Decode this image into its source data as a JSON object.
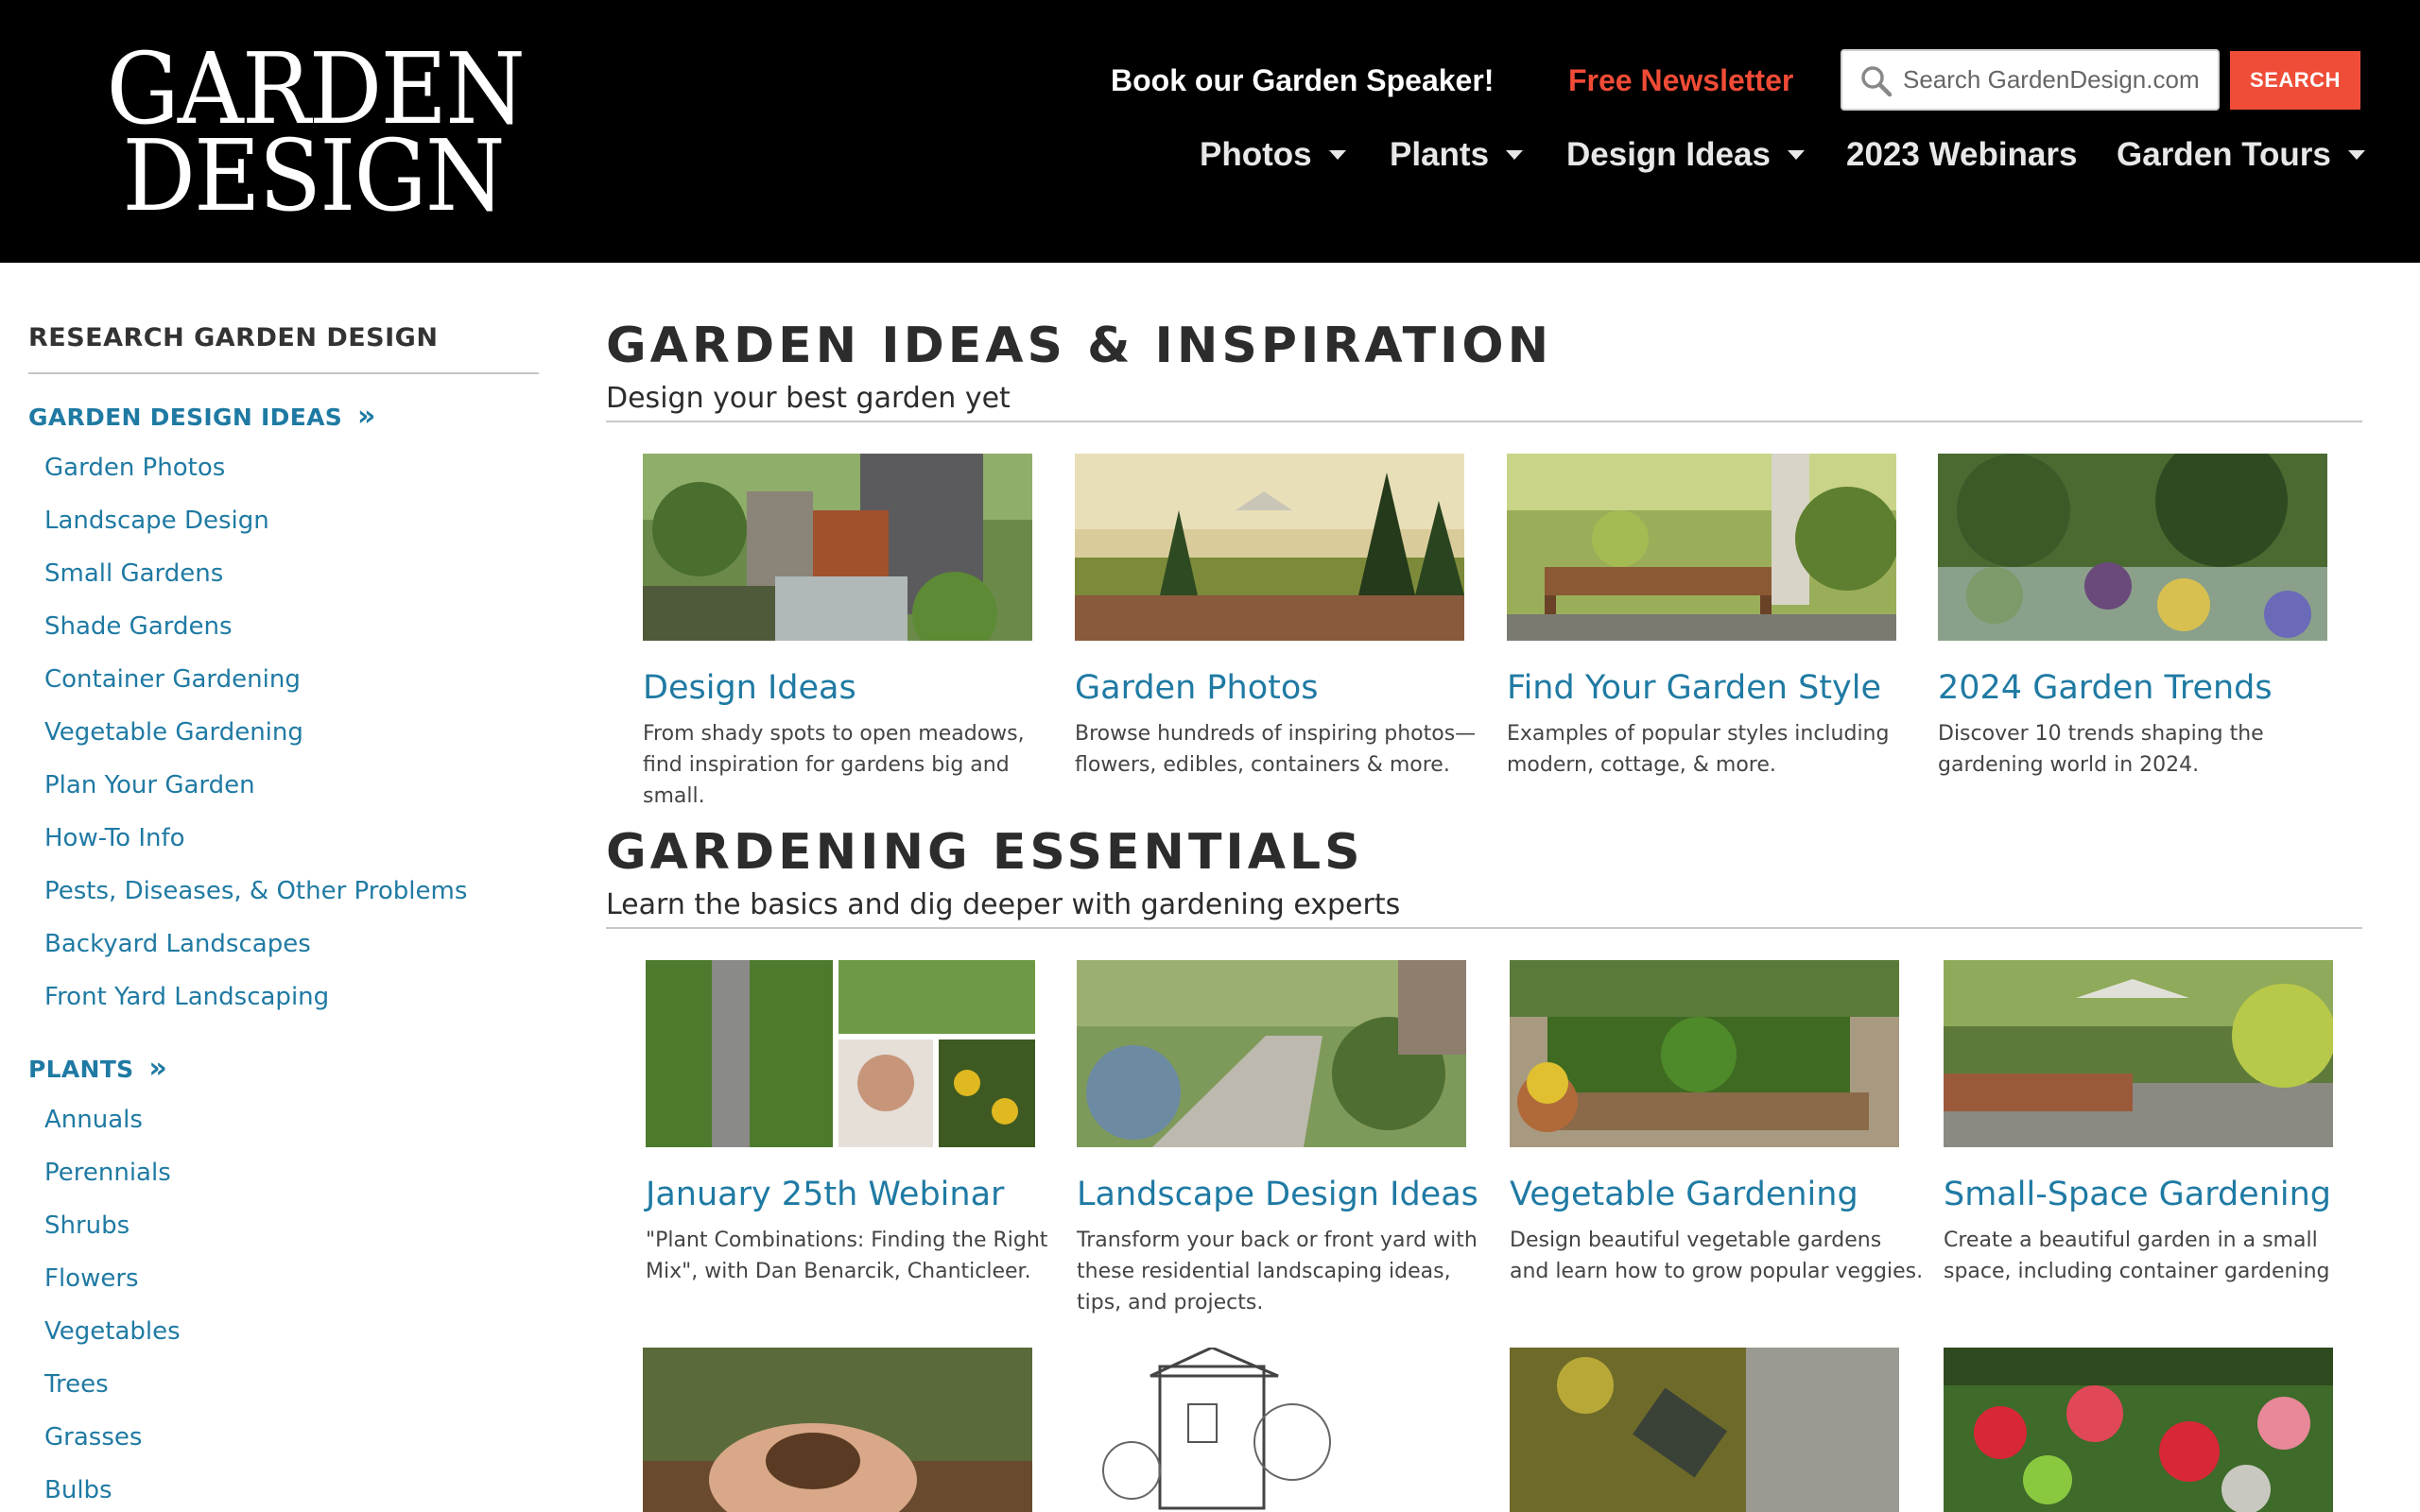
{
  "header": {
    "logo_line1": "GARDEN",
    "logo_line2": "DESIGN",
    "speaker_link": "Book our Garden Speaker!",
    "newsletter_link": "Free Newsletter",
    "search_placeholder": "Search GardenDesign.com",
    "search_button": "SEARCH",
    "nav": {
      "photos": "Photos",
      "plants": "Plants",
      "design_ideas": "Design Ideas",
      "webinars": "2023 Webinars",
      "garden_tours": "Garden Tours"
    },
    "colors": {
      "background": "#000000",
      "accent": "#ef4d37",
      "link": "#1f7aa3"
    }
  },
  "sidebar": {
    "heading": "RESEARCH GARDEN DESIGN",
    "cat1": {
      "label": "GARDEN DESIGN IDEAS",
      "items": [
        "Garden Photos",
        "Landscape Design",
        "Small Gardens",
        "Shade Gardens",
        "Container Gardening",
        "Vegetable Gardening",
        "Plan Your Garden",
        "How-To Info",
        "Pests, Diseases, & Other Problems",
        "Backyard Landscapes",
        "Front Yard Landscaping"
      ]
    },
    "cat2": {
      "label": "PLANTS",
      "items": [
        "Annuals",
        "Perennials",
        "Shrubs",
        "Flowers",
        "Vegetables",
        "Trees",
        "Grasses",
        "Bulbs"
      ]
    }
  },
  "section1": {
    "title": "GARDEN IDEAS & INSPIRATION",
    "subtitle": "Design your best garden yet",
    "cards": [
      {
        "title": "Design Ideas",
        "desc": "From shady spots to open meadows, find inspiration for gardens big and small."
      },
      {
        "title": "Garden Photos",
        "desc": "Browse hundreds of inspiring photos—flowers, edibles, containers & more."
      },
      {
        "title": "Find Your Garden Style",
        "desc": "Examples of popular styles including modern, cottage, & more."
      },
      {
        "title": "2024 Garden Trends",
        "desc": "Discover 10 trends shaping the gardening world in 2024."
      }
    ]
  },
  "section2": {
    "title": "GARDENING ESSENTIALS",
    "subtitle": "Learn the basics and dig deeper with gardening experts",
    "cards": [
      {
        "title": "January 25th Webinar",
        "desc": "\"Plant Combinations: Finding the Right Mix\", with Dan Benarcik, Chanticleer."
      },
      {
        "title": "Landscape Design Ideas",
        "desc": "Transform your back or front yard with these residential landscaping ideas, tips, and projects."
      },
      {
        "title": "Vegetable Gardening",
        "desc": "Design beautiful vegetable gardens and learn how to grow popular veggies."
      },
      {
        "title": "Small-Space Gardening",
        "desc": "Create a beautiful garden in a small space, including container gardening"
      }
    ]
  }
}
